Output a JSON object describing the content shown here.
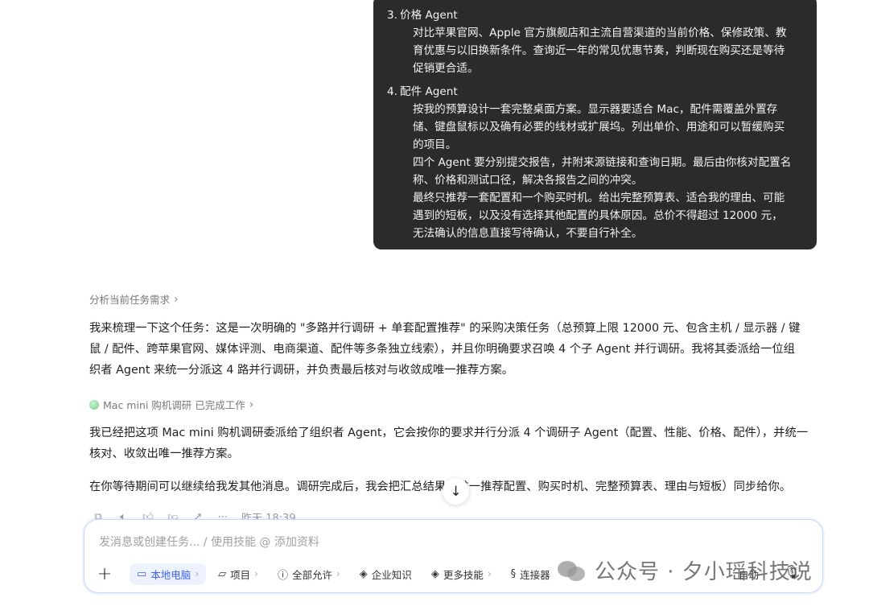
{
  "user_message": {
    "item3_num": "3.",
    "item3_title": "价格 Agent",
    "item3_lines": [
      "对比苹果官网、Apple 官方旗舰店和主流自营渠道的当前价格、保修政策、教",
      "育优惠与以旧换新条件。查询近一年的常见优惠节奏，判断现在购买还是等待",
      "促销更合适。"
    ],
    "item4_num": "4.",
    "item4_title": "配件 Agent",
    "item4_lines": [
      "按我的预算设计一套完整桌面方案。显示器要适合 Mac，配件需覆盖外置存",
      "储、键盘鼠标以及确有必要的线材或扩展坞。列出单价、用途和可以暂缓购买",
      "的项目。",
      "四个 Agent 要分别提交报告，并附来源链接和查询日期。最后由你核对配置名",
      "称、价格和测试口径，解决各报告之间的冲突。",
      "最终只推荐一套配置和一个购买时机。给出完整预算表、适合我的理由、可能",
      "遇到的短板，以及没有选择其他配置的具体原因。总价不得超过 12000 元，",
      "无法确认的信息直接写待确认，不要自行补全。"
    ]
  },
  "analysis_link": "分析当前任务需求",
  "reply_para1": [
    "我来梳理一下这个任务：这是一次明确的 \"多路并行调研 + 单套配置推荐\" 的采购决策任务（总预算上限 12000 元、包含主机 / 显示器 / 键",
    "鼠 / 配件、跨苹果官网、媒体评测、电商渠道、配件等多条独立线索），并且你明确要求召唤 4 个子 Agent 并行调研。我将其委派给一位组",
    "织者 Agent 来统一分派这 4 路并行调研，并负责最后核对与收敛成唯一推荐方案。"
  ],
  "task_status": "Mac mini 购机调研 已完成工作",
  "reply_para2": [
    "我已经把这项 Mac mini 购机调研委派给了组织者 Agent，它会按你的要求并行分派 4 个调研子 Agent（配置、性能、价格、配件），并统一",
    "核对、收敛出唯一推荐方案。"
  ],
  "reply_para3": "在你等待期间可以继续给我发其他消息。调研完成后，我会把汇总结果（唯一推荐配置、购买时机、完整预算表、理由与短板）同步给你。",
  "timestamp": "昨天 18:39",
  "composer": {
    "placeholder": "发消息或创建任务... / 使用技能 @ 添加资料",
    "tools": [
      "本地电脑",
      "项目",
      "全部允许",
      "企业知识",
      "更多技能",
      "连接器"
    ],
    "mode": "自动"
  },
  "watermark": "公众号 · 夕小瑶科技说",
  "colors": {
    "bubble_bg": "#2b2b2b",
    "accent": "#3e63f0"
  }
}
